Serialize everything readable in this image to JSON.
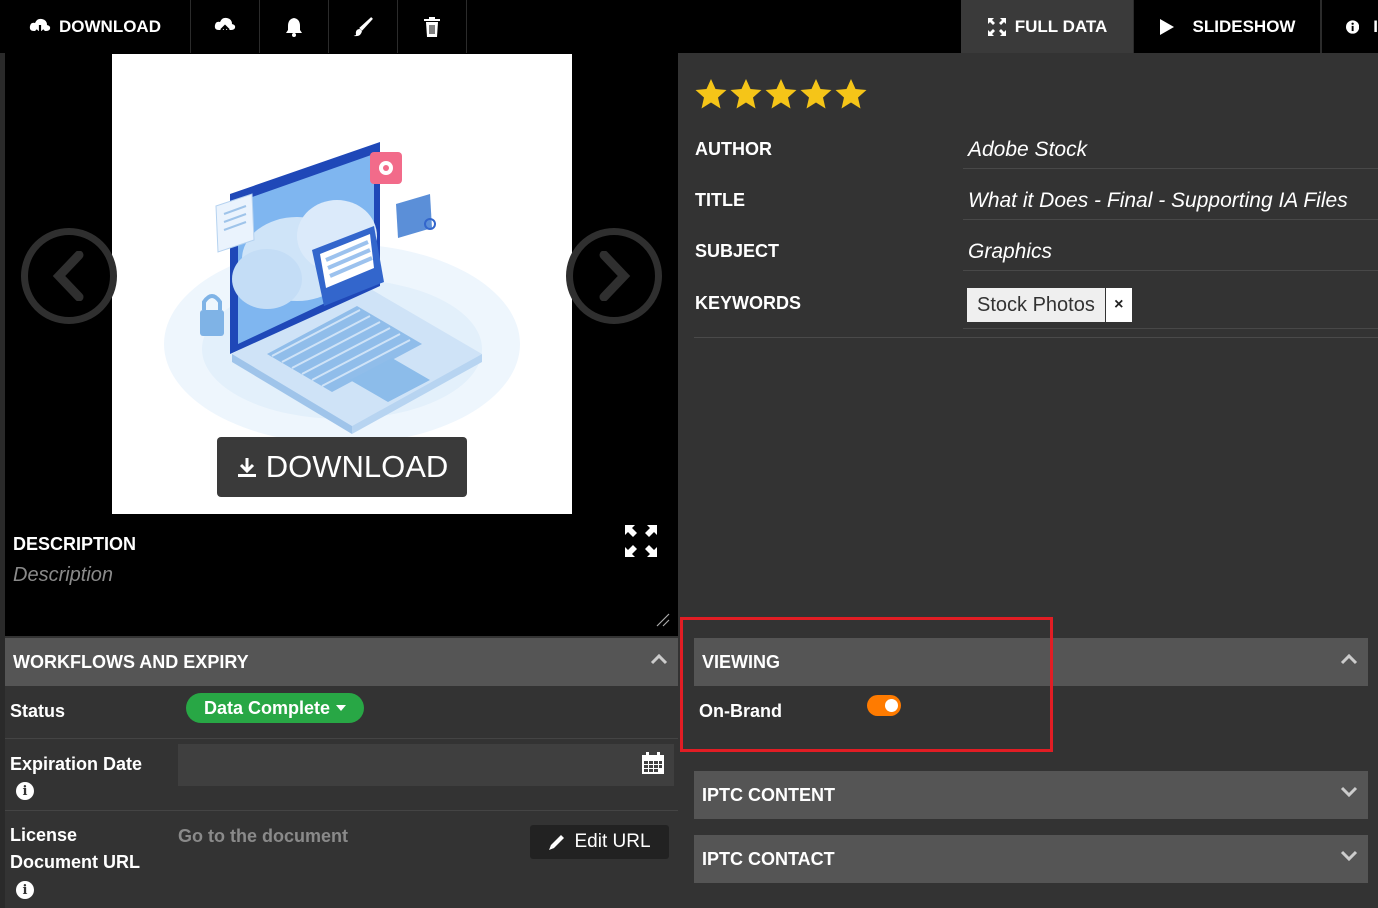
{
  "toolbar": {
    "download_label": "DOWNLOAD",
    "full_data_label": "FULL DATA",
    "slideshow_label": "SLIDESHOW",
    "info_label": "I",
    "icons": [
      "cloud-download-icon",
      "cloud-upload-icon",
      "bell-icon",
      "brush-icon",
      "trash-icon",
      "expand-icon",
      "play-icon",
      "info-icon"
    ]
  },
  "preview": {
    "download_overlay_label": "DOWNLOAD"
  },
  "description": {
    "label": "DESCRIPTION",
    "placeholder": "Description"
  },
  "workflows": {
    "title": "WORKFLOWS AND EXPIRY",
    "status_label": "Status",
    "status_value": "Data Complete",
    "status_color": "#28a745",
    "expiration_label": "Expiration Date",
    "license_label_line1": "License",
    "license_label_line2": "Document URL",
    "document_link": "Go to the document",
    "edit_url_label": "Edit URL"
  },
  "metadata": {
    "rating": 5,
    "rating_max": 5,
    "star_color": "#f5c518",
    "author_label": "AUTHOR",
    "author_value": "Adobe Stock",
    "title_label": "TITLE",
    "title_value": "What it Does - Final - Supporting IA Files",
    "subject_label": "SUBJECT",
    "subject_value": "Graphics",
    "keywords_label": "KEYWORDS",
    "keywords": [
      "Stock Photos"
    ]
  },
  "viewing": {
    "title": "VIEWING",
    "on_brand_label": "On-Brand",
    "on_brand_enabled": true,
    "toggle_color": "#ff7b00",
    "highlight_color": "#e11d24"
  },
  "sections": {
    "iptc_content": "IPTC CONTENT",
    "iptc_contact": "IPTC CONTACT"
  }
}
